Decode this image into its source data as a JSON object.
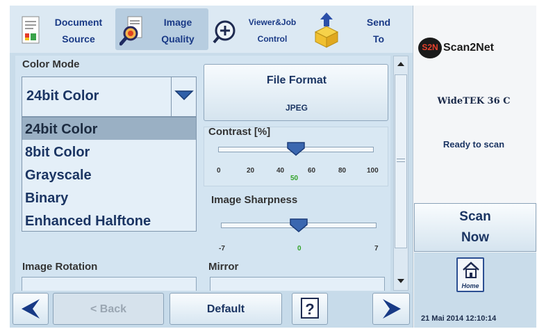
{
  "toolbar": {
    "document_source": {
      "line1": "Document",
      "line2": "Source"
    },
    "image_quality": {
      "line1": "Image",
      "line2": "Quality"
    },
    "viewer_job": {
      "line1": "Viewer&Job",
      "line2": "Control"
    },
    "send_to": {
      "line1": "Send",
      "line2": "To"
    }
  },
  "color_mode": {
    "label": "Color Mode",
    "value": "24bit Color",
    "options": [
      "24bit Color",
      "8bit Color",
      "Grayscale",
      "Binary",
      "Enhanced Halftone"
    ]
  },
  "file_format": {
    "title": "File Format",
    "value": "JPEG"
  },
  "contrast": {
    "label": "Contrast [%]",
    "ticks": [
      "0",
      "20",
      "40",
      "60",
      "80",
      "100"
    ],
    "value": 50,
    "value_label": "50",
    "min": 0,
    "max": 100
  },
  "sharpness": {
    "label": "Image Sharpness",
    "min_label": "-7",
    "max_label": "7",
    "value": 0,
    "value_label": "0",
    "min": -7,
    "max": 7
  },
  "image_rotation": {
    "label": "Image Rotation"
  },
  "mirror": {
    "label": "Mirror"
  },
  "right_pane": {
    "logo_badge": "S2N",
    "logo_text": "Scan2Net",
    "device": "WideTEK 36 C",
    "status": "Ready to scan",
    "scan_now_line1": "Scan",
    "scan_now_line2": "Now",
    "home_label": "Home",
    "datetime": "21 Mai 2014 12:10:14"
  },
  "bottom": {
    "back_label": "< Back",
    "default_label": "Default",
    "help_label": "?"
  },
  "colors": {
    "accent": "#1b3563",
    "panel": "#d3e4f1",
    "selected": "#9ab0c4",
    "value_green": "#33a329"
  }
}
